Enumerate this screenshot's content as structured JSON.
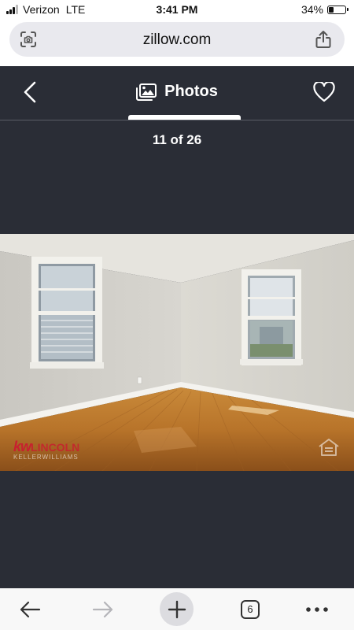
{
  "status_bar": {
    "carrier": "Verizon",
    "network": "LTE",
    "time": "3:41 PM",
    "battery": "34%",
    "battery_level": 0.34
  },
  "browser": {
    "url": "zillow.com",
    "left_icon": "page-scan-icon",
    "right_icon": "share-icon"
  },
  "gallery": {
    "title": "Photos",
    "counter": "11 of 26",
    "back_icon": "chevron-left-icon",
    "photos_icon": "photos-icon",
    "favorite_icon": "heart-icon"
  },
  "photo": {
    "watermark_brand": "kw",
    "watermark_office": "LINCOLN",
    "watermark_sub": "KELLERWILLIAMS"
  },
  "toolbar": {
    "back_icon": "arrow-left-icon",
    "forward_icon": "arrow-right-icon",
    "new_tab_icon": "plus-icon",
    "tabs_count": "6",
    "more_icon": "ellipsis-icon"
  },
  "colors": {
    "header_bg": "#2a2d36",
    "watermark_red": "#c8202f",
    "toolbar_bg": "#f8f8f8"
  }
}
